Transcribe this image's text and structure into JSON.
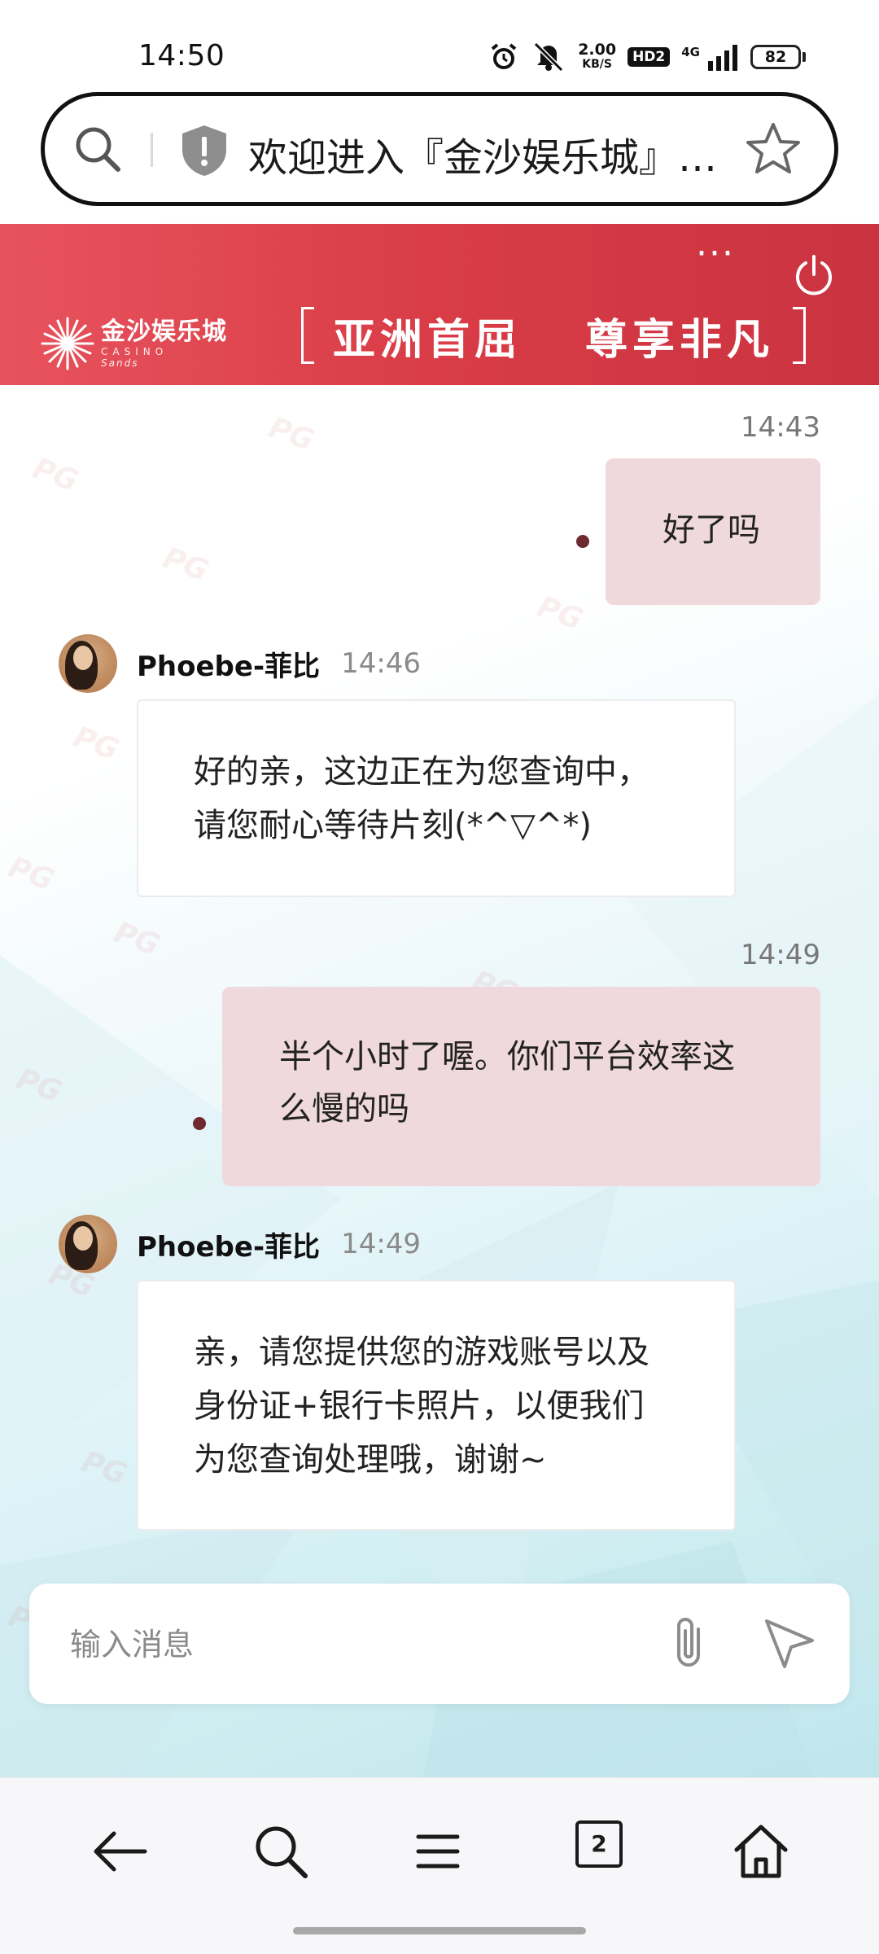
{
  "status_bar": {
    "time": "14:50",
    "speed_value": "2.00",
    "speed_unit": "KB/S",
    "hd_label": "HD2",
    "network_label": "4G",
    "battery": "82"
  },
  "url_bar": {
    "title": "欢迎进入『金沙娱乐城』…"
  },
  "banner": {
    "more_label": "···",
    "logo_cn": "金沙娱乐城",
    "logo_en": "CASINO",
    "logo_script": "Sands",
    "slogan_part1": "亚洲首屈",
    "slogan_part2": "尊享非凡",
    "colors": {
      "start": "#e7535d",
      "end": "#c93340"
    }
  },
  "messages": [
    {
      "direction": "out",
      "time": "14:43",
      "text": "好了吗"
    },
    {
      "direction": "in",
      "sender": "Phoebe-菲比",
      "time": "14:46",
      "lines": [
        "好的亲，这边正在为您查询中，",
        "请您耐心等待片刻(*^▽^*)"
      ]
    },
    {
      "direction": "out",
      "time": "14:49",
      "lines": [
        "半个小时了喔。你们平台效率这",
        "么慢的吗"
      ]
    },
    {
      "direction": "in",
      "sender": "Phoebe-菲比",
      "time": "14:49",
      "lines": [
        "亲，请您提供您的游戏账号以及",
        "身份证+银行卡照片，以便我们",
        "为您查询处理哦，谢谢~"
      ]
    }
  ],
  "input": {
    "placeholder": "输入消息"
  },
  "bottom_nav": {
    "tab_count": "2"
  },
  "icons": {
    "url_search": "search-icon",
    "url_shield": "shield-icon",
    "url_star": "star-icon",
    "banner_more": "more-icon",
    "banner_power": "power-icon",
    "attach": "paperclip-icon",
    "send": "send-icon",
    "nav_back": "back-arrow-icon",
    "nav_search": "search-icon",
    "nav_menu": "menu-icon",
    "nav_tabs": "tabs-icon",
    "nav_home": "home-icon"
  },
  "colors": {
    "outgoing_bubble": "#efd9dc",
    "incoming_bubble": "#ffffff",
    "unread_dot": "#6f2a2f",
    "banner_red": "#d93c46"
  }
}
